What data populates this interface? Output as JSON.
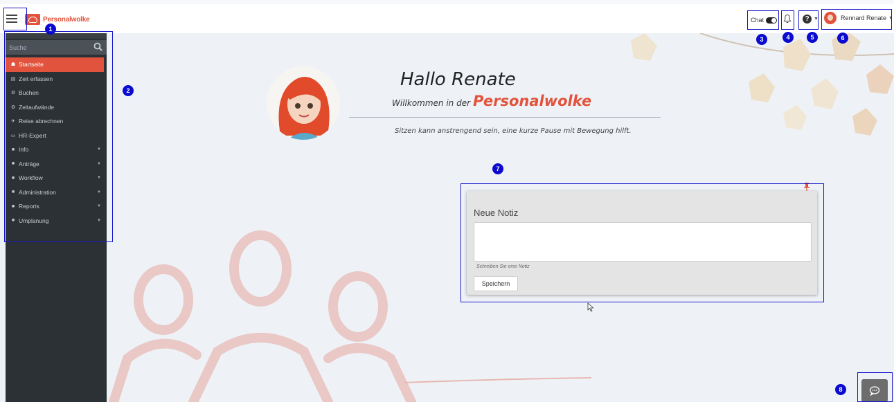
{
  "app": {
    "logo_text": "Personalwolke"
  },
  "header": {
    "chat_label": "Chat",
    "user_name": "Rennard Renate"
  },
  "sidebar": {
    "search_placeholder": "Suche",
    "items": [
      {
        "label": "Startseite",
        "icon": "home-icon",
        "glyph": "☗",
        "active": true,
        "has_caret": false
      },
      {
        "label": "Zeit erfassen",
        "icon": "table-icon",
        "glyph": "▤",
        "active": false,
        "has_caret": false
      },
      {
        "label": "Buchen",
        "icon": "gear-icon",
        "glyph": "⚙",
        "active": false,
        "has_caret": false
      },
      {
        "label": "Zeitaufwände",
        "icon": "gear-icon",
        "glyph": "⚙",
        "active": false,
        "has_caret": false
      },
      {
        "label": "Reise abrechnen",
        "icon": "plane-icon",
        "glyph": "✈",
        "active": false,
        "has_caret": false
      },
      {
        "label": "HR-Expert",
        "icon": "monitor-icon",
        "glyph": "▭",
        "active": false,
        "has_caret": false
      },
      {
        "label": "Info",
        "icon": "folder-icon",
        "glyph": "■",
        "active": false,
        "has_caret": true
      },
      {
        "label": "Anträge",
        "icon": "folder-icon",
        "glyph": "■",
        "active": false,
        "has_caret": true
      },
      {
        "label": "Workflow",
        "icon": "folder-icon",
        "glyph": "■",
        "active": false,
        "has_caret": true
      },
      {
        "label": "Administration",
        "icon": "folder-icon",
        "glyph": "■",
        "active": false,
        "has_caret": true
      },
      {
        "label": "Reports",
        "icon": "folder-icon",
        "glyph": "■",
        "active": false,
        "has_caret": true
      },
      {
        "label": "Umplanung",
        "icon": "folder-icon",
        "glyph": "■",
        "active": false,
        "has_caret": true
      }
    ]
  },
  "main": {
    "greeting": "Hallo Renate",
    "welcome_prefix": "Willkommen in der",
    "brand": "Personalwolke",
    "tip": "Sitzen kann anstrengend sein, eine kurze Pause mit Bewegung hilft."
  },
  "note": {
    "title": "Neue Notiz",
    "text_value": "",
    "help_text": "Schreiben Sie eine Notiz",
    "save_label": "Speichern"
  },
  "callouts": [
    "1",
    "2",
    "3",
    "4",
    "5",
    "6",
    "7",
    "8"
  ],
  "colors": {
    "accent": "#e2533d",
    "sidebar": "#2c3136",
    "callout": "#0a0ad0"
  }
}
